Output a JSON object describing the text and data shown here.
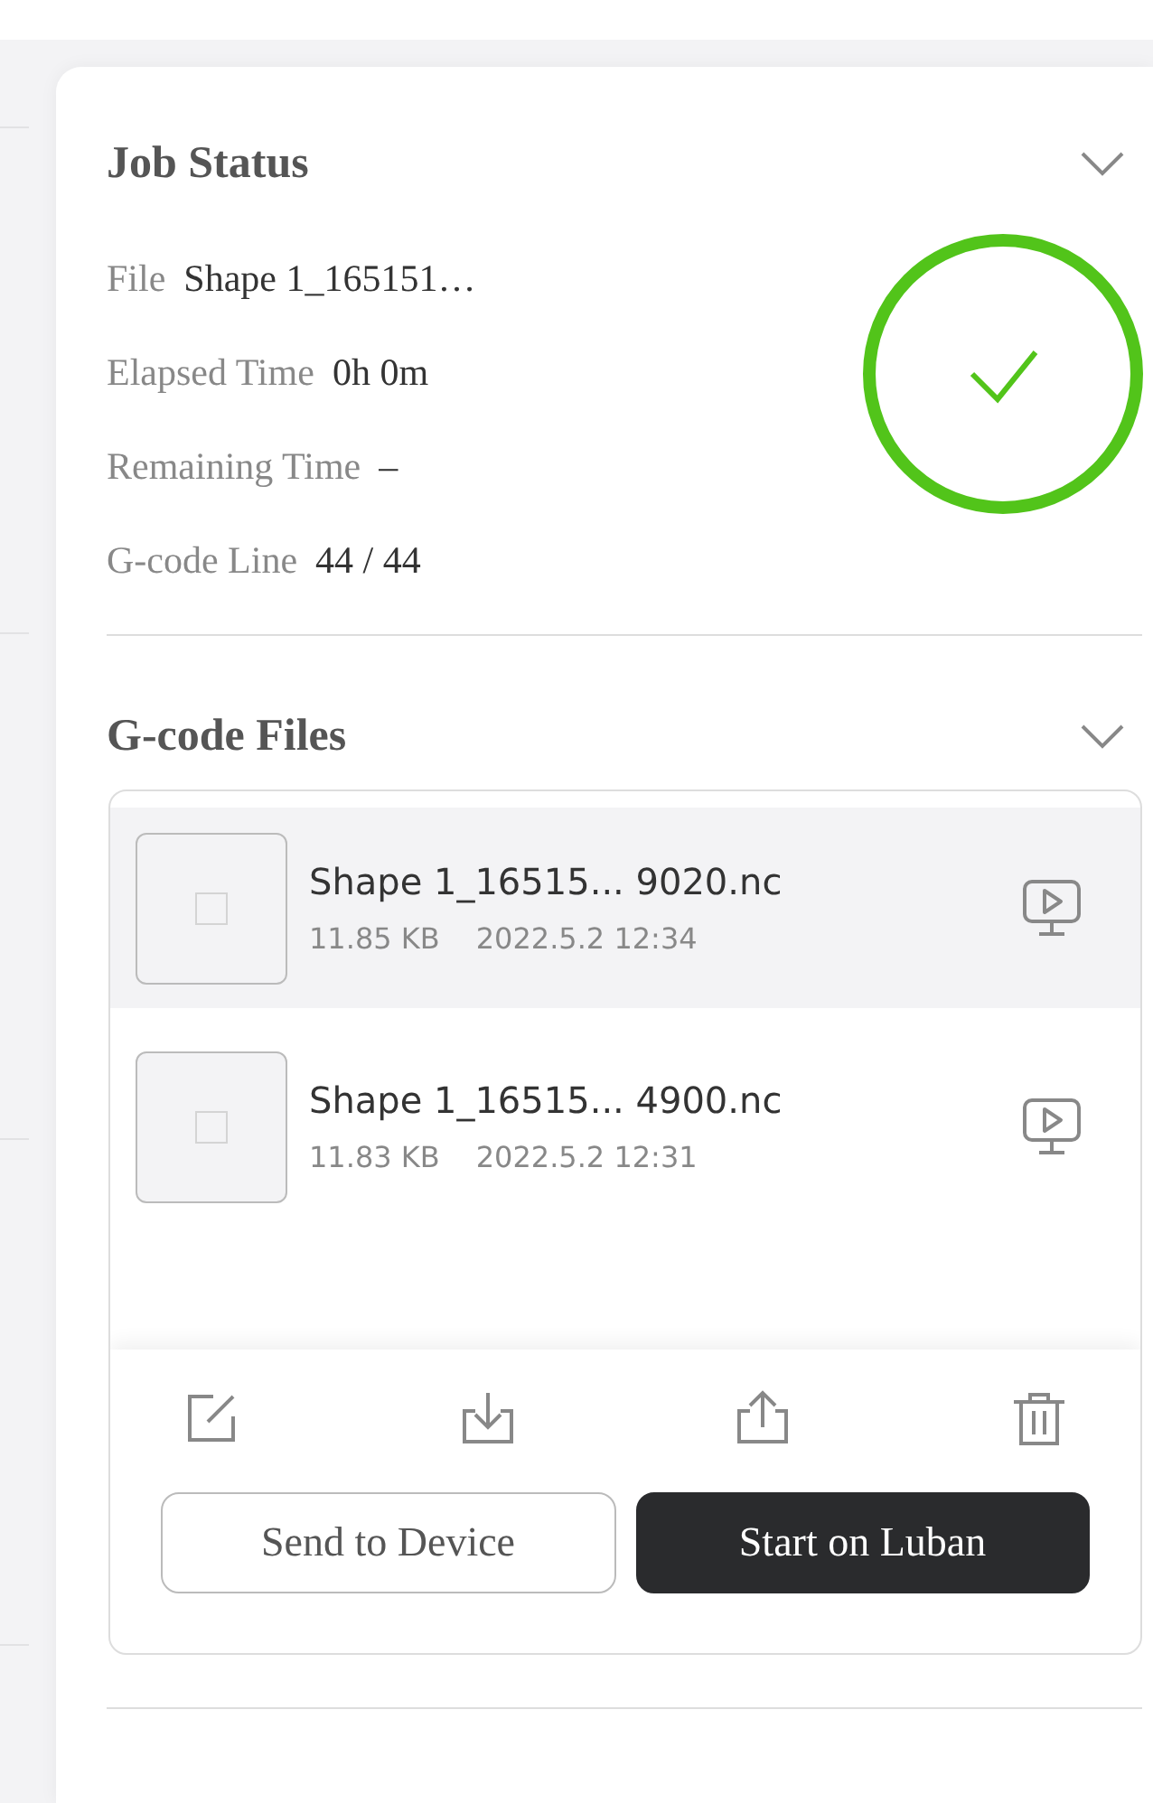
{
  "job_status": {
    "title": "Job Status",
    "done": true,
    "fields": [
      {
        "label": "File",
        "value": "Shape 1_165151…"
      },
      {
        "label": "Elapsed Time",
        "value": "0h 0m"
      },
      {
        "label": "Remaining Time",
        "value": "–"
      },
      {
        "label": "G-code Line",
        "value": "44 / 44"
      }
    ]
  },
  "gcode_files": {
    "title": "G-code Files",
    "files": [
      {
        "name": "Shape 1_16515... 9020.nc",
        "size": "11.85 KB",
        "date": "2022.5.2 12:34",
        "selected": true
      },
      {
        "name": "Shape 1_16515... 4900.nc",
        "size": "11.83 KB",
        "date": "2022.5.2 12:31",
        "selected": false
      }
    ],
    "buttons": [
      {
        "label": "Send to Device",
        "kind": "secondary"
      },
      {
        "label": "Start on Luban",
        "kind": "primary"
      }
    ]
  }
}
